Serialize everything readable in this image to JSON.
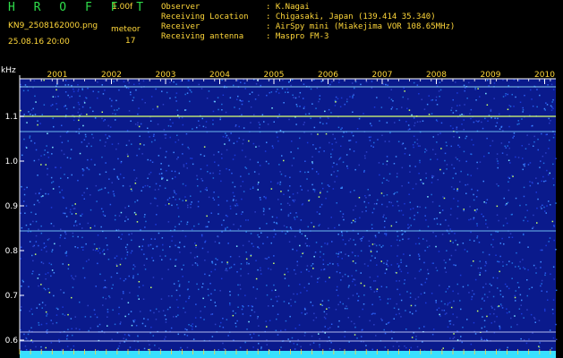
{
  "header": {
    "logo": "H R O F F T",
    "version": "1.00f",
    "filename": "KN9_2508162000.png",
    "meteor_label": "meteor",
    "timestamp": "25.08.16 20:00",
    "meteor_count": "17",
    "info": [
      {
        "key": "Observer",
        "value": ": K.Nagai"
      },
      {
        "key": "Receiving Location",
        "value": ": Chigasaki, Japan (139.414 35.340)"
      },
      {
        "key": "Receiver",
        "value": ": AirSpy mini (Miakejima VOR 108.65MHz)"
      },
      {
        "key": "Receiving antenna",
        "value": ": Maspro FM-3"
      }
    ]
  },
  "plot": {
    "y_unit": "kHz",
    "y_ticks": [
      "1.1",
      "1.0",
      "0.9",
      "0.8",
      "0.7",
      "0.6"
    ],
    "x_ticks": [
      "2001",
      "2002",
      "2003",
      "2004",
      "2005",
      "2006",
      "2007",
      "2008",
      "2009",
      "2010"
    ],
    "colors": {
      "background": "#0a1a8c",
      "bottom_band": "#38e0ff",
      "grid": "#ffffff"
    }
  }
}
